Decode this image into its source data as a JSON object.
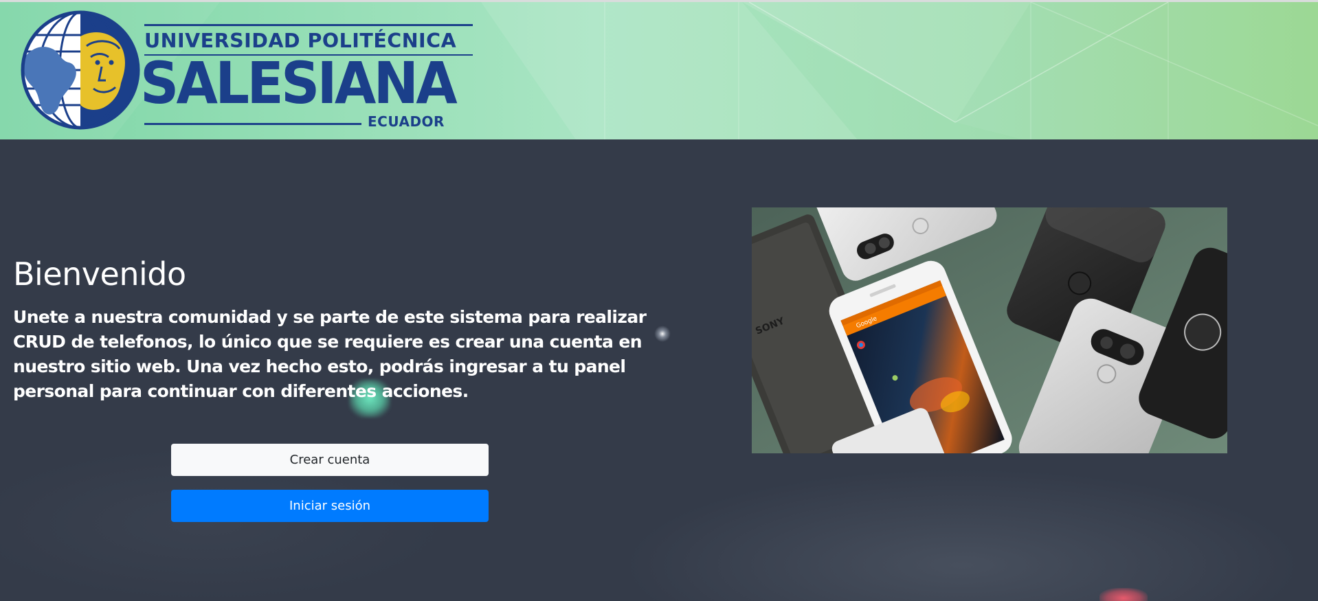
{
  "header": {
    "logo": {
      "line1": "UNIVERSIDAD POLITÉCNICA",
      "line2": "SALESIANA",
      "line3": "ECUADOR"
    }
  },
  "main": {
    "title": "Bienvenido",
    "description": "Unete a nuestra comunidad y se parte de este sistema para realizar CRUD de telefonos, lo único que se requiere es crear una cuenta en nuestro sitio web. Una vez hecho esto, podrás ingresar a tu panel personal para continuar con diferentes acciones.",
    "buttons": {
      "create_account": "Crear cuenta",
      "login": "Iniciar sesión"
    },
    "image": {
      "brand_text": "SONY",
      "app_label": "Google"
    }
  },
  "colors": {
    "banner_green": "#8fdcb0",
    "logo_blue": "#1b3f8a",
    "logo_gold": "#e7c12a",
    "background": "#343b49",
    "primary_button": "#007bff",
    "light_button": "#f8f9fa"
  }
}
